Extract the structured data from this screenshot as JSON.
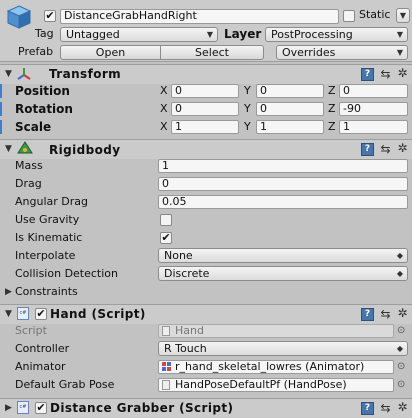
{
  "header": {
    "object_active": true,
    "object_name": "DistanceGrabHandRight",
    "static_label": "Static",
    "static_checked": false,
    "tag_label": "Tag",
    "tag_value": "Untagged",
    "layer_label": "Layer",
    "layer_value": "PostProcessing",
    "prefab_label": "Prefab",
    "open_label": "Open",
    "select_label": "Select",
    "overrides_label": "Overrides"
  },
  "transform": {
    "title": "Transform",
    "position": {
      "label": "Position",
      "x": "0",
      "y": "0",
      "z": "0"
    },
    "rotation": {
      "label": "Rotation",
      "x": "0",
      "y": "0",
      "z": "-90"
    },
    "scale": {
      "label": "Scale",
      "x": "1",
      "y": "1",
      "z": "1"
    },
    "axis_x": "X",
    "axis_y": "Y",
    "axis_z": "Z"
  },
  "rigidbody": {
    "title": "Rigidbody",
    "mass_label": "Mass",
    "mass": "1",
    "drag_label": "Drag",
    "drag": "0",
    "angular_drag_label": "Angular Drag",
    "angular_drag": "0.05",
    "use_gravity_label": "Use Gravity",
    "use_gravity": false,
    "is_kinematic_label": "Is Kinematic",
    "is_kinematic": true,
    "interpolate_label": "Interpolate",
    "interpolate": "None",
    "collision_label": "Collision Detection",
    "collision": "Discrete",
    "constraints_label": "Constraints"
  },
  "hand": {
    "title": "Hand (Script)",
    "enabled": true,
    "script_label": "Script",
    "script_value": "Hand",
    "controller_label": "Controller",
    "controller_value": "R Touch",
    "animator_label": "Animator",
    "animator_value": "r_hand_skeletal_lowres (Animator)",
    "grab_pose_label": "Default Grab Pose",
    "grab_pose_value": "HandPoseDefaultPf (HandPose)"
  },
  "distance_grabber": {
    "title": "Distance Grabber (Script)",
    "enabled": true
  },
  "icons": {
    "help": "help-icon",
    "preset": "preset-icon",
    "gear": "gear-icon"
  },
  "colors": {
    "background": "#c2c2c2",
    "accent_blue": "#3d7ed1"
  }
}
